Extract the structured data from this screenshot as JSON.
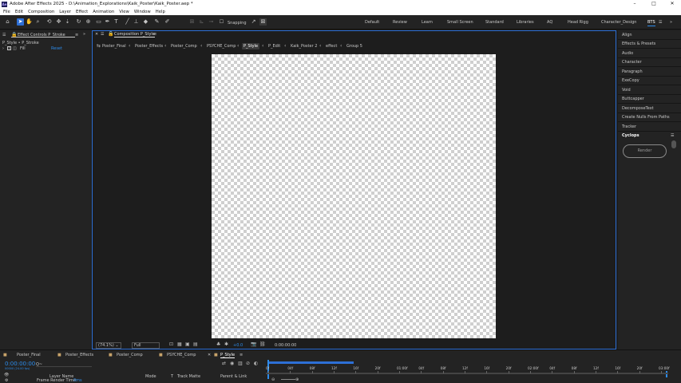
{
  "window": {
    "title": "Adobe After Effects 2025 - D:\\Animation_Explorations\\Kaik_Poster\\Kaik_Poster.aep *",
    "minimize": "–",
    "maximize": "□",
    "close": "✕"
  },
  "menu": [
    "File",
    "Edit",
    "Composition",
    "Layer",
    "Effect",
    "Animation",
    "View",
    "Window",
    "Help"
  ],
  "toolbar": {
    "snapping_label": "Snapping",
    "workspaces": [
      "Default",
      "Review",
      "Learn",
      "Small Screen",
      "Standard",
      "Libraries",
      "AQ",
      "Head Rigg",
      "Character_Design",
      "BTS"
    ],
    "active_workspace": "BTS"
  },
  "effect_controls": {
    "tab_label": "Effect Controls P_Stroke",
    "layer_path": "P_Style • P_Stroke",
    "effect_name": "Fill",
    "reset_label": "Reset"
  },
  "composition": {
    "tab_label": "Composition P_Style",
    "breadcrumbs": [
      "Poster_Final",
      "Poster_Effects",
      "Poster_Comp",
      "PSYCHE_Comp",
      "P_Style",
      "P_Edit",
      "Kaik_Poster 2",
      "effect",
      "Group 5"
    ],
    "active_breadcrumb": "P_Style",
    "zoom": "(74.1%)",
    "resolution": "Full",
    "exposure": "+0.0",
    "timecode": "0:00:00:00"
  },
  "right_panel": {
    "items": [
      "Align",
      "Effects & Presets",
      "Audio",
      "Character",
      "Paragraph",
      "ExeCopy",
      "Void",
      "Buttcapper",
      "DecomposeText",
      "Create Nulls From Paths",
      "Tracker",
      "Cyclops"
    ],
    "render_button": "Render"
  },
  "timeline": {
    "tabs": [
      "Poster_Final",
      "Poster_Effects",
      "Poster_Comp",
      "PSYCHE_Comp",
      "P_Style"
    ],
    "active_tab": "P_Style",
    "current_time": "0:00:00:00",
    "frame_info": "00000 (24.00 fps)",
    "search_placeholder": "Q~",
    "columns": [
      "Layer Name",
      "Mode",
      "T",
      "Track Matte",
      "Parent & Link"
    ],
    "ruler_ticks": [
      "0f",
      "04f",
      "08f",
      "12f",
      "16f",
      "20f",
      "01:00f",
      "04f",
      "08f",
      "12f",
      "16f",
      "20f",
      "02:00f",
      "04f",
      "08f",
      "12f",
      "16f",
      "20f",
      "03:00f"
    ],
    "render_time_label": "Frame Render Time:",
    "render_time_value": "0ms"
  }
}
